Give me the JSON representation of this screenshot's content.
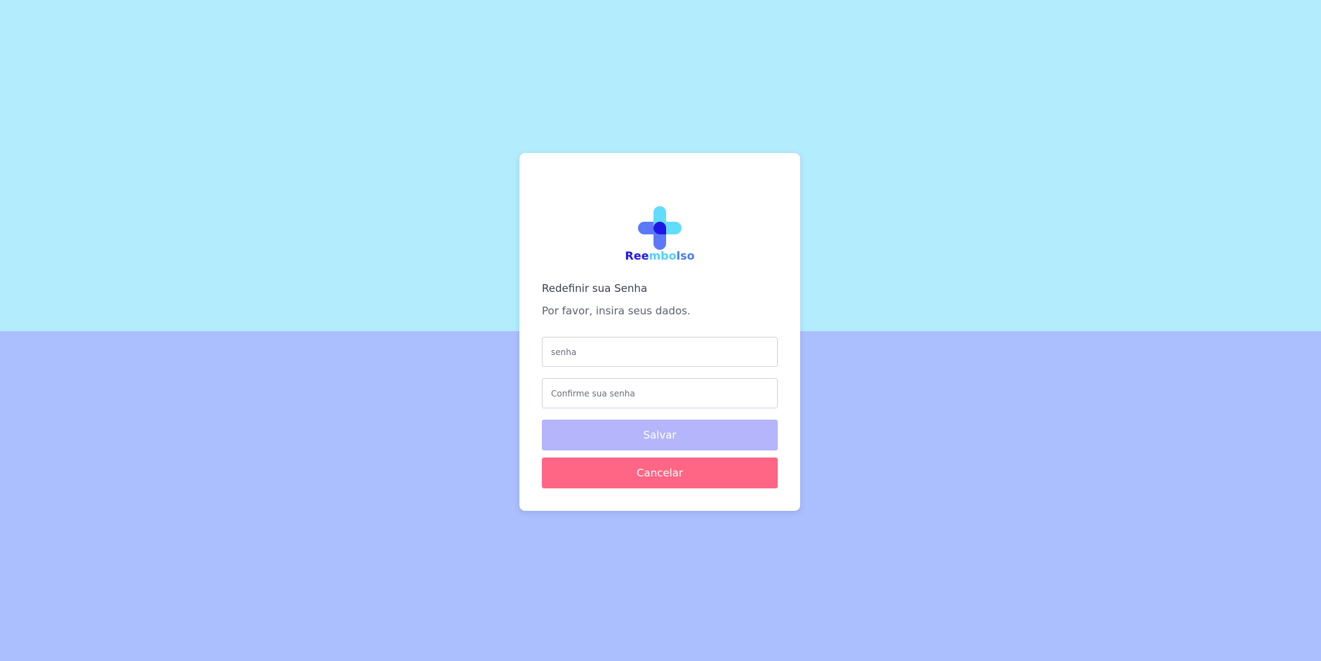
{
  "logo": {
    "name_parts": [
      "Ree",
      "mbo",
      "lso"
    ],
    "icon": "medical-cross-icon",
    "colors": [
      "#1f16e6",
      "#4fd2f4",
      "#4a7cf5"
    ]
  },
  "form": {
    "title": "Redefinir sua Senha",
    "subtitle": "Por favor, insira seus dados.",
    "password_placeholder": "senha",
    "confirm_placeholder": "Confirme sua senha",
    "password_value": "",
    "confirm_value": ""
  },
  "buttons": {
    "save_label": "Salvar",
    "cancel_label": "Cancelar"
  },
  "colors": {
    "background_top": "#b3ecfd",
    "background_bottom": "#abbefe",
    "save_button": "#b5b5fb",
    "cancel_button": "#ff6584"
  }
}
